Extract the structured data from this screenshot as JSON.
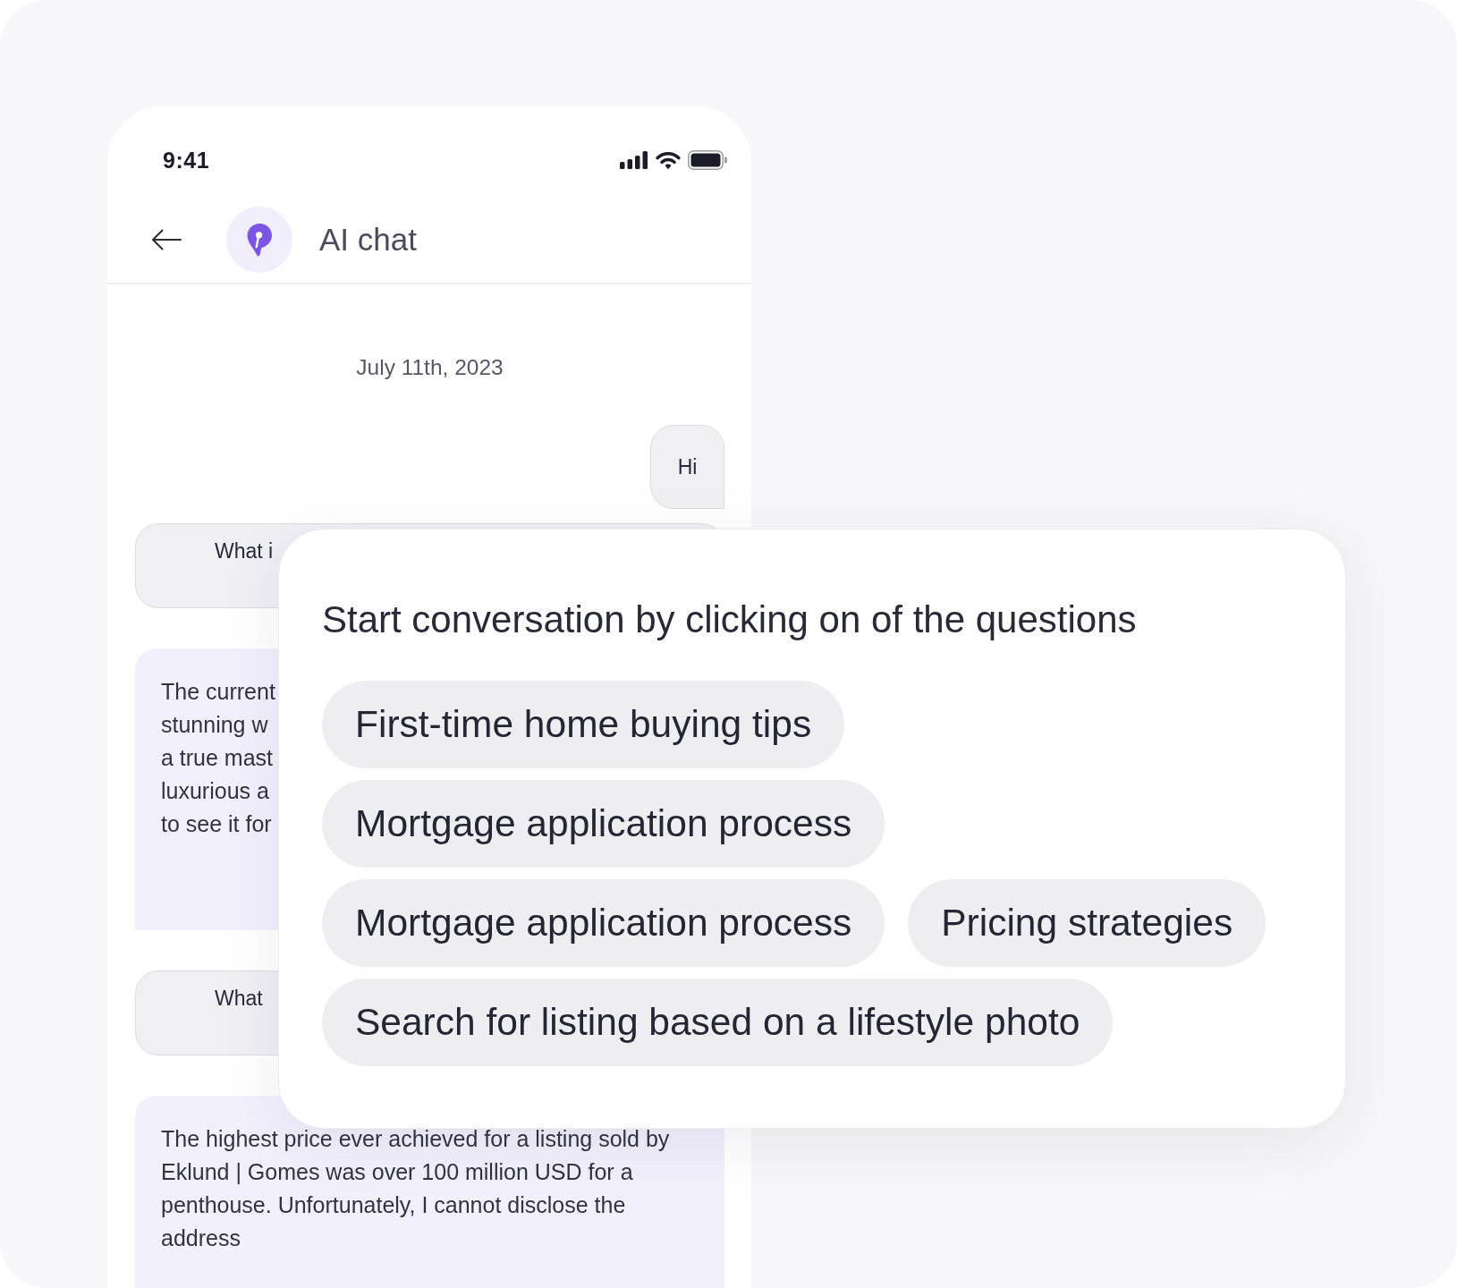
{
  "status_bar": {
    "time": "9:41"
  },
  "header": {
    "title": "AI chat"
  },
  "chat": {
    "date": "July 11th, 2023",
    "messages": [
      {
        "kind": "greeting",
        "lines": [
          "Hi"
        ]
      },
      {
        "kind": "question",
        "lines": [
          "What i"
        ]
      },
      {
        "kind": "answer",
        "lines": [
          "The current",
          "stunning w",
          "a true mast",
          "luxurious a",
          "to see it for"
        ]
      },
      {
        "kind": "question",
        "lines": [
          "What"
        ]
      },
      {
        "kind": "answer",
        "lines": [
          "The highest price ever achieved for a listing sold by",
          "Eklund | Gomes was over 100 million USD for a",
          "penthouse. Unfortunately, I cannot disclose the",
          "address"
        ]
      }
    ]
  },
  "suggestions": {
    "title": "Start conversation by clicking on of the questions",
    "rows": [
      [
        "First-time home buying tips"
      ],
      [
        "Mortgage application process"
      ],
      [
        "Mortgage application process",
        "Pricing strategies"
      ],
      [
        "Search for listing based on a lifestyle photo"
      ]
    ]
  }
}
